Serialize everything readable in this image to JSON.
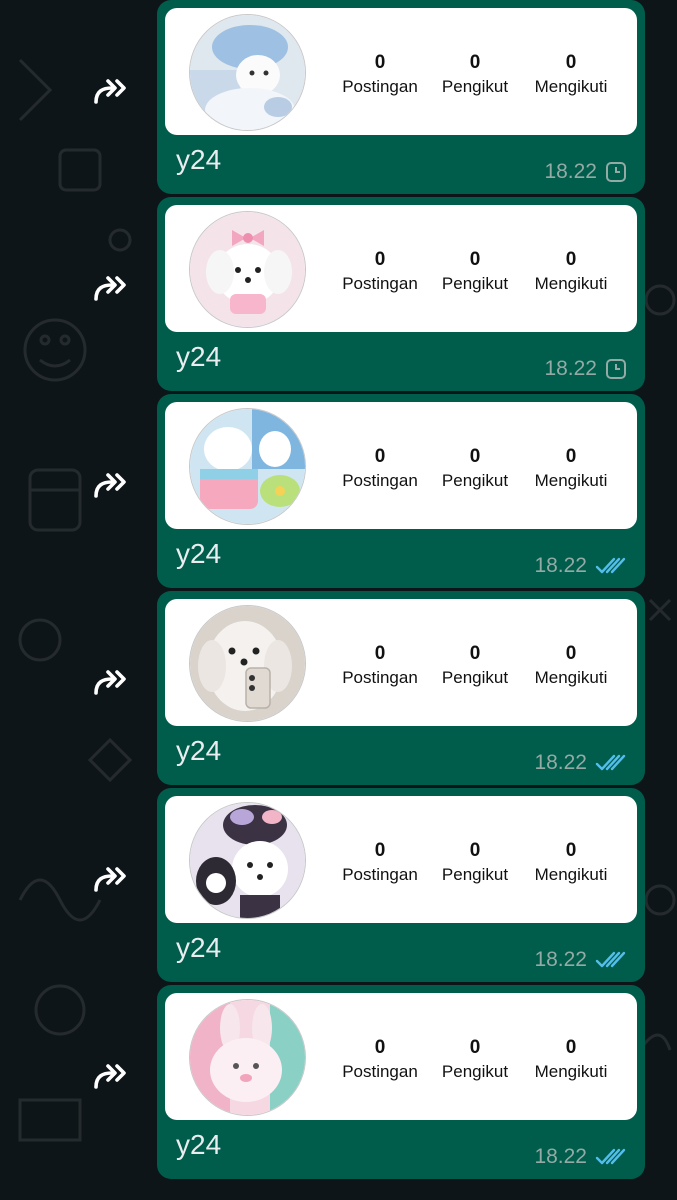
{
  "chat": {
    "messages": [
      {
        "avatar": "cat-plush-photo",
        "stats": [
          {
            "value": "0",
            "label": "Postingan"
          },
          {
            "value": "0",
            "label": "Pengikut"
          },
          {
            "value": "0",
            "label": "Mengikuti"
          }
        ],
        "caption": "y24",
        "time": "18.22",
        "status": "pending-clock-icon"
      },
      {
        "avatar": "white-dog-pink-bow-photo",
        "stats": [
          {
            "value": "0",
            "label": "Postingan"
          },
          {
            "value": "0",
            "label": "Pengikut"
          },
          {
            "value": "0",
            "label": "Mengikuti"
          }
        ],
        "caption": "y24",
        "time": "18.22",
        "status": "pending-clock-icon"
      },
      {
        "avatar": "pastel-cake-photo",
        "stats": [
          {
            "value": "0",
            "label": "Postingan"
          },
          {
            "value": "0",
            "label": "Pengikut"
          },
          {
            "value": "0",
            "label": "Mengikuti"
          }
        ],
        "caption": "y24",
        "time": "18.22",
        "status": "read-double-check-icon"
      },
      {
        "avatar": "fluffy-white-dog-phone-photo",
        "stats": [
          {
            "value": "0",
            "label": "Postingan"
          },
          {
            "value": "0",
            "label": "Pengikut"
          },
          {
            "value": "0",
            "label": "Mengikuti"
          }
        ],
        "caption": "y24",
        "time": "18.22",
        "status": "read-double-check-icon"
      },
      {
        "avatar": "dog-with-kuromi-plush-photo",
        "stats": [
          {
            "value": "0",
            "label": "Postingan"
          },
          {
            "value": "0",
            "label": "Pengikut"
          },
          {
            "value": "0",
            "label": "Mengikuti"
          }
        ],
        "caption": "y24",
        "time": "18.22",
        "status": "read-double-check-icon"
      },
      {
        "avatar": "pink-bunny-photo",
        "stats": [
          {
            "value": "0",
            "label": "Postingan"
          },
          {
            "value": "0",
            "label": "Pengikut"
          },
          {
            "value": "0",
            "label": "Mengikuti"
          }
        ],
        "caption": "y24",
        "time": "18.22",
        "status": "read-double-check-icon"
      }
    ]
  },
  "colors": {
    "background": "#0e1518",
    "bubble": "#005c4b",
    "card": "#ffffff",
    "time_text": "#93aaa5",
    "read_ticks": "#53bdeb"
  }
}
